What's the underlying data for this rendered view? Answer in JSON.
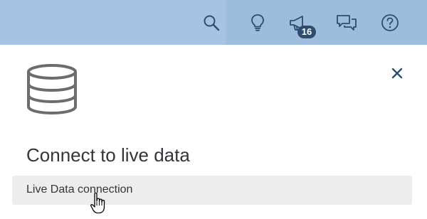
{
  "header": {
    "background_color": "#a7c3e1",
    "icon_color": "#2d4d6e",
    "actions": [
      {
        "icon": "search-icon"
      },
      {
        "icon": "lightbulb-icon"
      },
      {
        "icon": "megaphone-icon",
        "badge": "16"
      },
      {
        "icon": "chat-icon"
      },
      {
        "icon": "help-icon"
      }
    ]
  },
  "panel": {
    "icon": "database-icon",
    "close_icon": "close-icon",
    "title": "Connect to live data",
    "options": [
      {
        "label": "Live Data connection"
      }
    ]
  },
  "pointer": {
    "icon": "hand-cursor-icon"
  }
}
